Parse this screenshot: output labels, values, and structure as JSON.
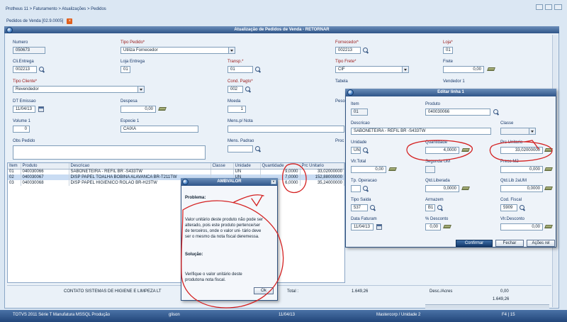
{
  "breadcrumb": "Protheus 11 > Faturamento > Atualizações > Pedidos",
  "tab_label": "Pedidos de Venda [02.9.0005]",
  "form_title": "Atualização de Pedidos de Venda - RETORNAR",
  "header": {
    "numero": {
      "label": "Numero",
      "value": "050673"
    },
    "tipo_pedido": {
      "label": "Tipo Pedido*",
      "value": "Utiliza Fornecedor"
    },
    "fornecedor": {
      "label": "Fornecedor*",
      "value": "002213"
    },
    "loja": {
      "label": "Loja*",
      "value": "01"
    },
    "cli_entrega": {
      "label": "Cli.Entrega",
      "value": "002213"
    },
    "loja_entrega": {
      "label": "Loja Entrega",
      "value": "01"
    },
    "transp": {
      "label": "Transp.*",
      "value": "01"
    },
    "tipo_frete": {
      "label": "Tipo Frete*",
      "value": "CIF"
    },
    "frete": {
      "label": "Frete",
      "value": "0,00"
    },
    "tipo_cliente": {
      "label": "Tipo Cliente*",
      "value": "Revendedor"
    },
    "cond_pagto": {
      "label": "Cond. Pagto*",
      "value": "002"
    },
    "tabela": {
      "label": "Tabela"
    },
    "vendedor": {
      "label": "Vendedor 1"
    },
    "dt_emissao": {
      "label": "DT Emissao",
      "value": "11/04/13"
    },
    "despesa": {
      "label": "Despesa",
      "value": "0,00"
    },
    "moeda": {
      "label": "Moeda",
      "value": "1"
    },
    "peso": {
      "label": "Peso"
    },
    "volume": {
      "label": "Volume 1",
      "value": "0"
    },
    "especie": {
      "label": "Especie 1",
      "value": "CAIXA"
    },
    "mens_nota": {
      "label": "Mens.p/ Nota"
    },
    "obs_pedido": {
      "label": "Obs Pedido"
    },
    "mens_padrao": {
      "label": "Mens. Padrao"
    },
    "proc": {
      "label": "Proc"
    }
  },
  "grid": {
    "columns": [
      "Item",
      "Produto",
      "Descricao",
      "Classe",
      "Unidade",
      "Quantidade",
      "Prc Unitario"
    ],
    "rows": [
      {
        "item": "01",
        "produto": "040030066",
        "descricao": "SABONETEIRA - REFIL BR -S433TW",
        "classe": "",
        "unidade": "UN",
        "quantidade": "9,0000",
        "preco": "33,02000000"
      },
      {
        "item": "02",
        "produto": "040030067",
        "descricao": "DISP PAPEL TOALHA BOBINA ALAVANCA BR-T211TW",
        "classe": "",
        "unidade": "UN",
        "quantidade": "7,0000",
        "preco": "152,88000000"
      },
      {
        "item": "03",
        "produto": "040030068",
        "descricao": "DISP PAPEL HIGIENICO ROLAO BR-H23TW",
        "classe": "",
        "unidade": "UN",
        "quantidade": "6,0000",
        "preco": "35,24000000"
      }
    ]
  },
  "footer": {
    "company": "CONTATO SISTEMAS DE HIGIENE E LIMPEZA LT",
    "total_label": "Total :",
    "total_value": "1.649,26",
    "desc_label": "Desc./Acres",
    "desc_value": "0,00",
    "total2_value": "1.649,26"
  },
  "editor": {
    "title": "Editar linha 1",
    "item": {
      "label": "Item",
      "value": "01"
    },
    "produto": {
      "label": "Produto",
      "value": "040030066"
    },
    "descricao": {
      "label": "Descricao",
      "value": "SABONETEIRA - REFIL BR -S433TW"
    },
    "classe": {
      "label": "Classe"
    },
    "unidade": {
      "label": "Unidade",
      "value": "UN"
    },
    "quantidade": {
      "label": "Quantidade",
      "value": "4,0000"
    },
    "prc_unitario": {
      "label": "Prc Unitario",
      "value": "33,02000000"
    },
    "vlr_total": {
      "label": "Vlr.Total",
      "value": "0,00"
    },
    "segunda_um": {
      "label": "Segunda UM"
    },
    "preco_m2": {
      "label": "Preco M2",
      "value": "0,000"
    },
    "tp_operacao": {
      "label": "Tp. Operacao"
    },
    "qtd_liberada": {
      "label": "Qtd.Liberada",
      "value": "0,0000"
    },
    "qtd_lib_2aum": {
      "label": "Qtd.Lib 2aUM",
      "value": "0,0000"
    },
    "tipo_saida": {
      "label": "Tipo Saida",
      "value": "537"
    },
    "armazem": {
      "label": "Armazem",
      "value": "B1"
    },
    "cod_fiscal": {
      "label": "Cod. Fiscal",
      "value": "5909"
    },
    "data_faturam": {
      "label": "Data Faturam",
      "value": "11/04/13"
    },
    "pct_desconto": {
      "label": "% Desconto",
      "value": "0,00"
    },
    "vlr_desconto": {
      "label": "Vlr.Desconto",
      "value": "0,00"
    },
    "btn_confirmar": "Confirmar",
    "btn_fechar": "Fechar",
    "btn_acoes": "Ações rel"
  },
  "alert": {
    "title": "AMBVALOR",
    "problema_label": "Problema:",
    "problema_text": "Valor unitário deste produto não pode ser alterado, pois este produto pertence/ser de terceiros, onde o valor uni- tário deve ser o mesmo da nota fiscal deremessa.",
    "solucao_label": "Solução:",
    "solucao_text": "Verifique o valor unitário deste produtona nota fiscal.",
    "ok_label": "Ok"
  },
  "statusbar": {
    "product": "TOTVS 2011 Série T Manufatura MSSQL Produção",
    "user": "glison",
    "date": "11/04/13",
    "company": "Mastercorp / Unidade 2",
    "keys": "F4 | 15"
  },
  "colors": {
    "titlebar": "#2f5589",
    "annotation": "#d42020",
    "highlight_row": "#c9dcf3"
  }
}
